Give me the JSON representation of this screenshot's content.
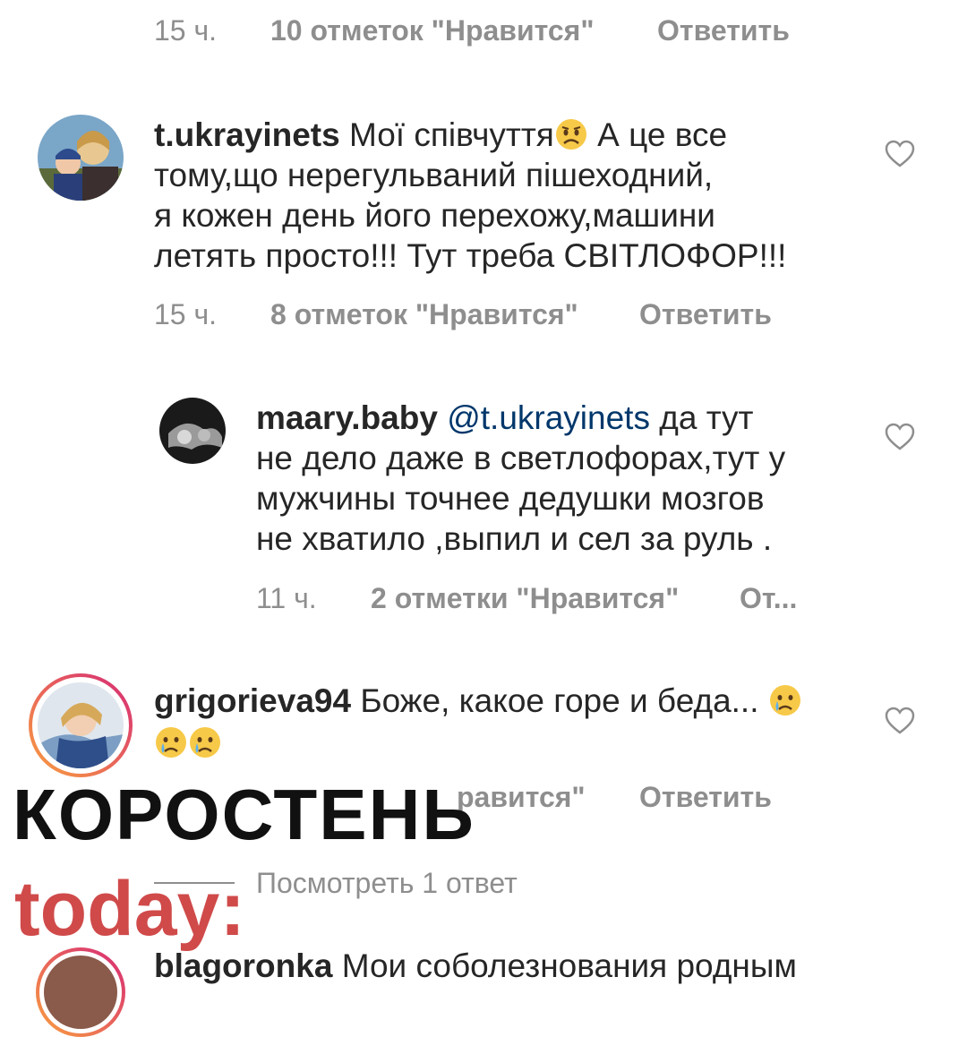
{
  "colors": {
    "text": "#262626",
    "meta": "#8e8e8e",
    "mention": "#00376b",
    "story_ring_start": "#f9a03f",
    "story_ring_end": "#d62976",
    "logo_dark": "#111111",
    "logo_red": "#d04a4a"
  },
  "top_meta": {
    "time": "15 ч.",
    "likes": "10 отметок \"Нравится\"",
    "reply": "Ответить"
  },
  "comments": [
    {
      "username": "t.ukrayinets",
      "lines": [
        "Мої співчуття",
        "тому,що нерегульваний пішеходний,",
        "я кожен день його перехожу,машини",
        "летять просто!!! Тут треба СВІТЛОФОР!!!"
      ],
      "after_emoji": "А це все",
      "emoji": "sad-face-emoji",
      "time": "15 ч.",
      "likes": "8 отметок \"Нравится\"",
      "reply": "Ответить",
      "like_icon": "heart-outline-icon"
    },
    {
      "username": "maary.baby",
      "mention": "@t.ukrayinets",
      "lines": [
        "да тут",
        "не дело даже в светлофорах,тут у",
        "мужчины точнее дедушки мозгов",
        "не хватило ,выпил и сел за руль ."
      ],
      "time": "11 ч.",
      "likes": "2 отметки \"Нравится\"",
      "reply": "От...",
      "like_icon": "heart-outline-icon"
    },
    {
      "username": "grigorieva94",
      "text": "Боже, какое горе и беда...",
      "emoji": "crying-face-emoji",
      "likes_partial": "равится\"",
      "reply": "Ответить",
      "like_icon": "heart-outline-icon"
    }
  ],
  "view_replies": "Посмотреть 1 ответ",
  "bottom_cut": {
    "username_partial": "blagoronka",
    "text_partial": "Мои соболезнования родным"
  },
  "watermark": {
    "line1": "КОРОСТЕНЬ",
    "line2": "today:"
  }
}
